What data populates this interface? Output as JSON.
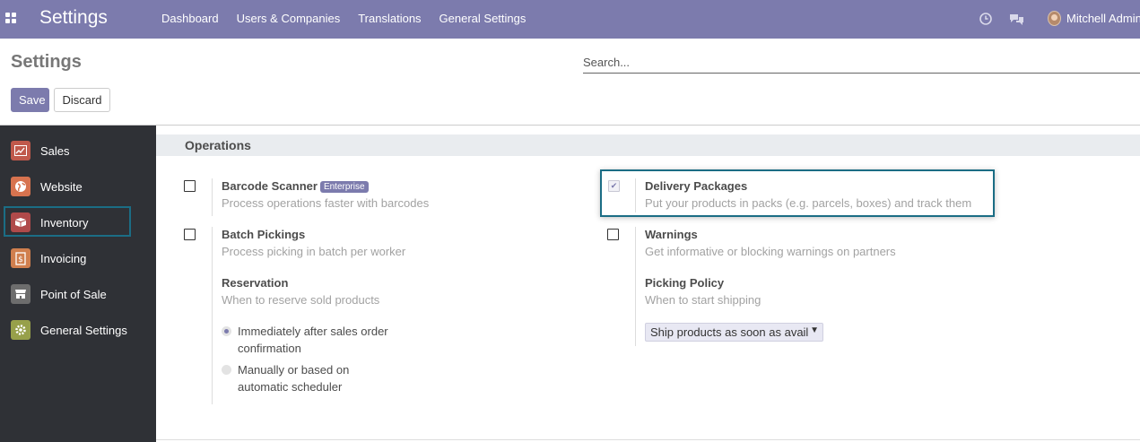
{
  "topbar": {
    "app_title": "Settings",
    "menu": [
      "Dashboard",
      "Users & Companies",
      "Translations",
      "General Settings"
    ],
    "user_name": "Mitchell Admin",
    "color": "#7c7bad"
  },
  "control_panel": {
    "breadcrumb": "Settings",
    "search_placeholder": "Search...",
    "save_label": "Save",
    "discard_label": "Discard"
  },
  "sidebar": {
    "items": [
      {
        "label": "Sales",
        "icon": "sales-chart-icon",
        "color": "#c0594b"
      },
      {
        "label": "Website",
        "icon": "globe-icon",
        "color": "#d7734f"
      },
      {
        "label": "Inventory",
        "icon": "box-icon",
        "color": "#b04a4a",
        "active": true
      },
      {
        "label": "Invoicing",
        "icon": "invoice-icon",
        "color": "#d07f4e"
      },
      {
        "label": "Point of Sale",
        "icon": "store-icon",
        "color": "#6d6d6d"
      },
      {
        "label": "General Settings",
        "icon": "gear-icon",
        "color": "#97a04a"
      }
    ]
  },
  "main": {
    "section_title": "Operations",
    "settings": {
      "barcode": {
        "title": "Barcode Scanner",
        "badge": "Enterprise",
        "desc": "Process operations faster with barcodes",
        "checked": false
      },
      "delivery": {
        "title": "Delivery Packages",
        "desc": "Put your products in packs (e.g. parcels, boxes) and track them",
        "checked": true
      },
      "batch": {
        "title": "Batch Pickings",
        "desc": "Process picking in batch per worker",
        "checked": false
      },
      "warnings": {
        "title": "Warnings",
        "desc": "Get informative or blocking warnings on partners",
        "checked": false
      },
      "reservation": {
        "title": "Reservation",
        "desc": "When to reserve sold products",
        "options": [
          {
            "line1": "Immediately after sales order",
            "line2": "confirmation",
            "selected": true
          },
          {
            "line1": "Manually or based on",
            "line2": "automatic scheduler",
            "selected": false
          }
        ]
      },
      "picking_policy": {
        "title": "Picking Policy",
        "desc": "When to start shipping",
        "selected": "Ship products as soon as avail"
      }
    }
  }
}
